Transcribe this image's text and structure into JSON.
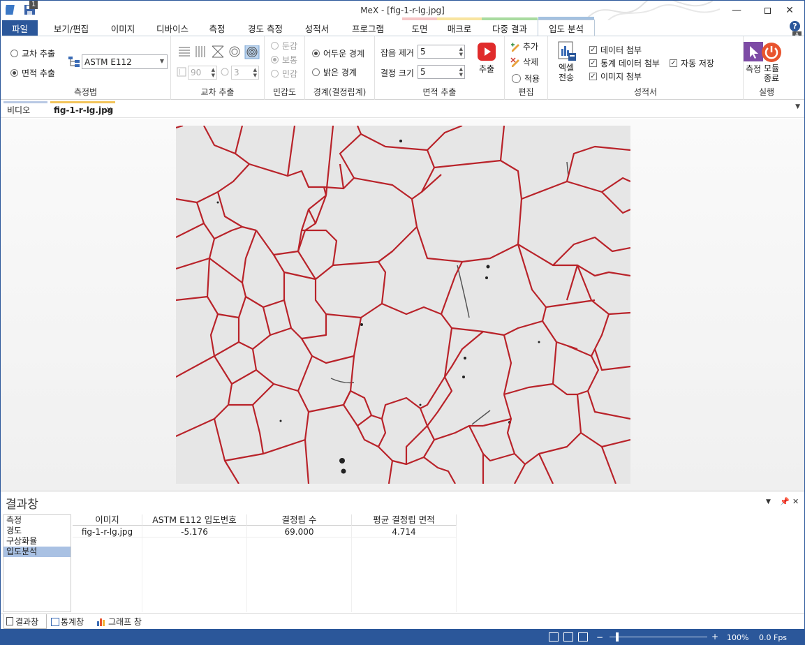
{
  "window": {
    "title": "MeX - [fig-1-r-lg.jpg]",
    "qa_badge": "1"
  },
  "tabs": [
    {
      "label": "파일"
    },
    {
      "label": "보기/편집"
    },
    {
      "label": "이미지"
    },
    {
      "label": "디바이스"
    },
    {
      "label": "측정"
    },
    {
      "label": "경도 측정"
    },
    {
      "label": "성적서"
    },
    {
      "label": "프로그램"
    },
    {
      "label": "도면"
    },
    {
      "label": "매크로"
    },
    {
      "label": "다중 결과"
    },
    {
      "label": "입도 분석"
    }
  ],
  "ribbon": {
    "method": {
      "group_label": "측정법",
      "option_intercept": "교차 추출",
      "option_area": "면적 추출",
      "standard": "ASTM E112"
    },
    "intercept": {
      "group_label": "교차 추출",
      "angle": "90",
      "count": "3"
    },
    "sensitivity": {
      "group_label": "민감도",
      "dull": "둔감",
      "normal": "보통",
      "sensitive": "민감"
    },
    "boundary": {
      "group_label": "경계(결정립계)",
      "dark": "어두운 경계",
      "bright": "밝은 경계"
    },
    "area": {
      "group_label": "면적 추출",
      "noise_label": "잡음 제거",
      "noise_value": "5",
      "grain_label": "결정 크기",
      "grain_value": "5",
      "extract_label": "추출"
    },
    "edit": {
      "group_label": "편집",
      "add": "추가",
      "delete": "삭제",
      "apply": "적용"
    },
    "report": {
      "group_label": "성적서",
      "excel": "엑셀",
      "excel2": "전송",
      "attach_data": "데이터 첨부",
      "attach_stats": "통계 데이터 첨부",
      "attach_image": "이미지 첨부",
      "auto_save": "자동 저장"
    },
    "run": {
      "group_label": "실행",
      "measure": "측정",
      "exit1": "모듈",
      "exit2": "종료"
    }
  },
  "doc_tabs": [
    {
      "label": "비디오"
    },
    {
      "label": "fig-1-r-lg.jpg"
    }
  ],
  "results": {
    "title": "결과창",
    "list": [
      "측정",
      "경도",
      "구상화율",
      "입도분석"
    ],
    "columns": [
      "이미지",
      "ASTM E112 입도번호",
      "결정립 수",
      "평균 결정립 면적"
    ],
    "rows": [
      [
        "fig-1-r-lg.jpg",
        "-5.176",
        "69.000",
        "4.714"
      ]
    ],
    "bottom_tabs": [
      "결과창",
      "통계창",
      "그래프 창"
    ]
  },
  "status": {
    "zoom": "100%",
    "fps": "0.0 Fps"
  },
  "colors": {
    "accent": "#2b579a",
    "boundary": "#c0262d",
    "extract": "#e02b2b",
    "run": "#7d4ba5",
    "exit": "#e8542f"
  }
}
